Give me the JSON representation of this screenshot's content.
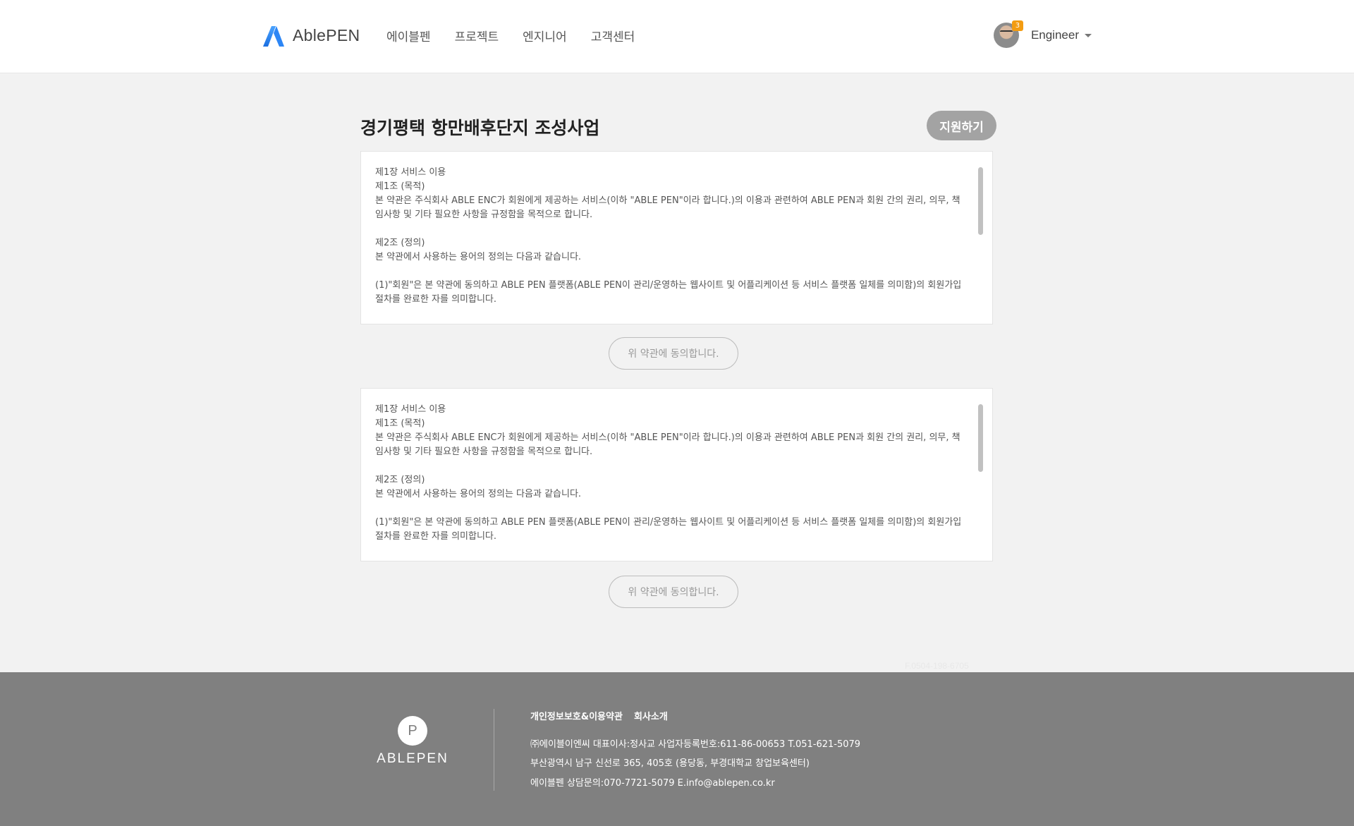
{
  "header": {
    "logo_text": "AblePEN",
    "nav": [
      "에이블펜",
      "프로젝트",
      "엔지니어",
      "고객센터"
    ],
    "user": {
      "name": "Engineer",
      "badge_count": "3"
    }
  },
  "main": {
    "title": "경기평택 항만배후단지 조성사업",
    "apply_label": "지원하기",
    "terms": [
      {
        "text": "제1장 서비스 이용\n제1조 (목적)\n본 약관은 주식회사 ABLE ENC가 회원에게 제공하는 서비스(이하 \"ABLE PEN\"이라 합니다.)의 이용과 관련하여 ABLE PEN과 회원 간의 권리, 의무, 책임사항 및 기타 필요한 사항을 규정함을 목적으로 합니다.\n\n제2조 (정의)\n본 약관에서 사용하는 용어의 정의는 다음과 같습니다.\n\n(1)\"회원\"은 본 약관에 동의하고 ABLE PEN 플랫폼(ABLE PEN이 관리/운영하는 웹사이트 및 어플리케이션 등 서비스 플랫폼 일체를 의미함)의 회원가입 절차를 완료한 자를 의미합니다.",
        "agree_label": "위 약관에 동의합니다."
      },
      {
        "text": "제1장 서비스 이용\n제1조 (목적)\n본 약관은 주식회사 ABLE ENC가 회원에게 제공하는 서비스(이하 \"ABLE PEN\"이라 합니다.)의 이용과 관련하여 ABLE PEN과 회원 간의 권리, 의무, 책임사항 및 기타 필요한 사항을 규정함을 목적으로 합니다.\n\n제2조 (정의)\n본 약관에서 사용하는 용어의 정의는 다음과 같습니다.\n\n(1)\"회원\"은 본 약관에 동의하고 ABLE PEN 플랫폼(ABLE PEN이 관리/운영하는 웹사이트 및 어플리케이션 등 서비스 플랫폼 일체를 의미함)의 회원가입 절차를 완료한 자를 의미합니다.",
        "agree_label": "위 약관에 동의합니다."
      }
    ],
    "faint_text": "F.0504-198-6705"
  },
  "footer": {
    "logo_letter": "P",
    "logo_text": "ABLEPEN",
    "links": [
      "개인정보보호&이용약관",
      "회사소개"
    ],
    "company_line": "㈜에이블이엔씨   대표이사:정사교   사업자등록번호:611-86-00653   T.051-621-5079",
    "address_line": "부산광역시 남구 신선로 365, 405호 (용당동, 부경대학교 창업보육센터)",
    "contact_line": "에이블펜 상담문의:070-7721-5079    E.info@ablepen.co.kr"
  }
}
